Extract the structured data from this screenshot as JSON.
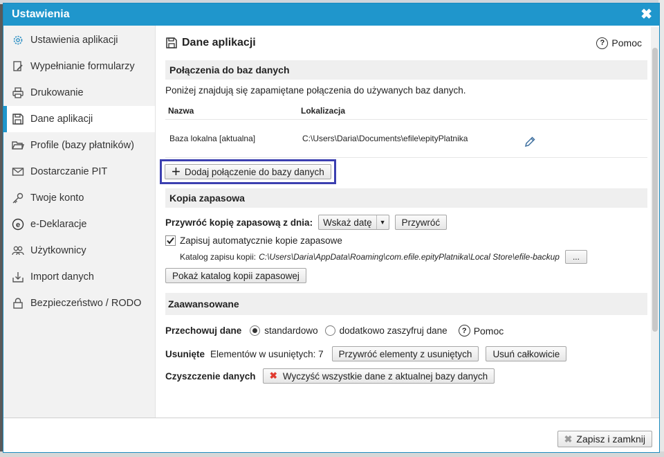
{
  "dialog": {
    "title": "Ustawienia",
    "close_label": "✖"
  },
  "sidebar": {
    "items": [
      {
        "label": "Ustawienia aplikacji"
      },
      {
        "label": "Wypełnianie formularzy"
      },
      {
        "label": "Drukowanie"
      },
      {
        "label": "Dane aplikacji"
      },
      {
        "label": "Profile (bazy płatników)"
      },
      {
        "label": "Dostarczanie PIT"
      },
      {
        "label": "Twoje konto"
      },
      {
        "label": "e-Deklaracje"
      },
      {
        "label": "Użytkownicy"
      },
      {
        "label": "Import danych"
      },
      {
        "label": "Bezpieczeństwo / RODO"
      }
    ],
    "active_index": 3
  },
  "main": {
    "title": "Dane aplikacji",
    "help_label": "Pomoc",
    "connections": {
      "heading": "Połączenia do baz danych",
      "description": "Poniżej znajdują się zapamiętane połączenia do używanych baz danych.",
      "col_name": "Nazwa",
      "col_location": "Lokalizacja",
      "rows": [
        {
          "name": "Baza lokalna [aktualna]",
          "location": "C:\\Users\\Daria\\Documents\\efile\\epityPlatnika"
        }
      ],
      "add_button": "Dodaj połączenie do bazy danych"
    },
    "backup": {
      "heading": "Kopia zapasowa",
      "restore_label": "Przywróć kopię zapasową z dnia:",
      "date_select": "Wskaż datę",
      "restore_button": "Przywróć",
      "auto_backup_label": "Zapisuj automatycznie kopie zapasowe",
      "auto_backup_checked": true,
      "dir_label": "Katalog zapisu kopii:",
      "dir_path": "C:\\Users\\Daria\\AppData\\Roaming\\com.efile.epityPlatnika\\Local Store\\efile-backup",
      "browse_button": "...",
      "show_dir_button": "Pokaż katalog kopii zapasowej"
    },
    "advanced": {
      "heading": "Zaawansowane",
      "store_label": "Przechowuj dane",
      "option_standard": "standardowo",
      "option_encrypt": "dodatkowo zaszyfruj dane",
      "selected_option": "standardowo",
      "help_label": "Pomoc",
      "deleted_label": "Usunięte",
      "deleted_count_text": "Elementów w usuniętych: 7",
      "restore_deleted_button": "Przywróć elementy z usuniętych",
      "delete_all_button": "Usuń całkowicie",
      "cleanup_label": "Czyszczenie danych",
      "clear_button": "Wyczyść wszystkie dane z aktualnej bazy danych"
    }
  },
  "footer": {
    "save_close_button": "Zapisz i zamknij"
  },
  "colors": {
    "accent": "#1f96cc",
    "highlight": "#3b3fb0",
    "danger": "#e03a2f"
  }
}
